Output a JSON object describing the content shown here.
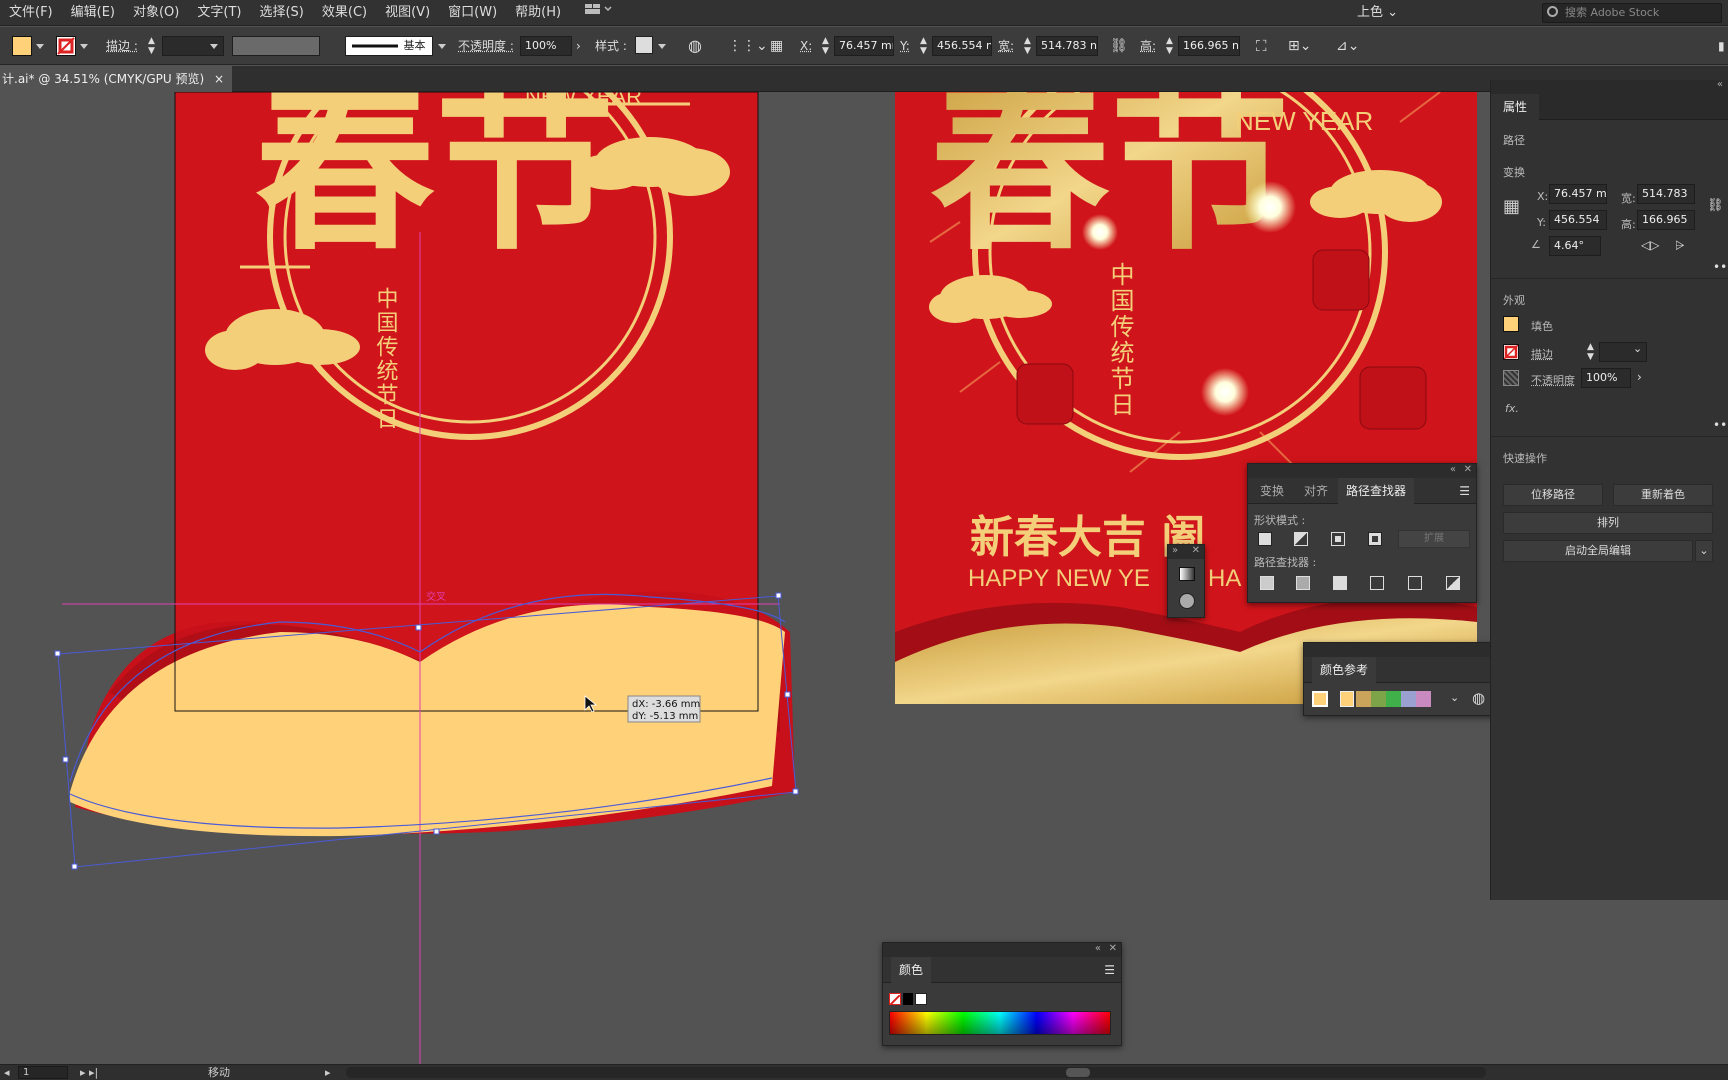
{
  "menu": {
    "items": [
      "文件(F)",
      "编辑(E)",
      "对象(O)",
      "文字(T)",
      "选择(S)",
      "效果(C)",
      "视图(V)",
      "窗口(W)",
      "帮助(H)"
    ],
    "workspace": "上色",
    "search_placeholder": "搜索 Adobe Stock"
  },
  "control": {
    "stroke_label": "描边 :",
    "stroke_style": "基本",
    "opacity_label": "不透明度 :",
    "opacity_value": "100%",
    "style_label": "样式 :",
    "x_label": "X:",
    "x_value": "76.457 mm",
    "y_label": "Y:",
    "y_value": "456.554 n",
    "w_label": "宽:",
    "w_value": "514.783 n",
    "h_label": "高:",
    "h_value": "166.965 n",
    "fill_color": "#ffd27a"
  },
  "document": {
    "tab_title": "计.ai* @ 34.51% (CMYK/GPU 预览)",
    "close": "×"
  },
  "canvas": {
    "left_art": {
      "title": "春节",
      "subtitle_cn": "中国传统节日",
      "new_year": "NEW YEAR"
    },
    "right_art": {
      "title": "春节",
      "subtitle_cn": "中国传统节日",
      "new_year": "NEW YEAR",
      "greeting_cn": "新春大吉 阖",
      "greeting_en": "HAPPY NEW YE",
      "greeting_en2": "HA"
    },
    "smart_guide_label": "交叉",
    "delta_x": "dX: -3.66 mm",
    "delta_y": "dY: -5.13 mm"
  },
  "properties": {
    "tab": "属性",
    "path_label": "路径",
    "transform_label": "变换",
    "x_label": "X:",
    "x_value": "76.457 m",
    "y_label": "Y:",
    "y_value": "456.554",
    "w_label": "宽:",
    "w_value": "514.783",
    "h_label": "高:",
    "h_value": "166.965",
    "angle_value": "4.64°",
    "appearance_label": "外观",
    "fill_label": "填色",
    "stroke_label": "描边",
    "opacity_label": "不透明度",
    "opacity_value": "100%",
    "fx_label": "fx.",
    "quick_actions_label": "快速操作",
    "offset_path": "位移路径",
    "recolor": "重新着色",
    "arrange": "排列",
    "global_edit": "启动全局编辑"
  },
  "pathfinder": {
    "tabs": [
      "变换",
      "对齐",
      "路径查找器"
    ],
    "shape_modes": "形状模式 :",
    "expand": "扩展",
    "pathfinders": "路径查找器 :"
  },
  "color_guide": {
    "title": "颜色参考",
    "swatches": [
      "#c9a45a",
      "#7ea44a",
      "#3fb04a",
      "#9aa0d0",
      "#c88ac0"
    ]
  },
  "color_panel": {
    "title": "颜色"
  },
  "status": {
    "page": "1",
    "tool": "移动"
  },
  "colors": {
    "poster_red": "#d0141b",
    "gold": "#f3cf7a",
    "wave": "#ffd27a",
    "selection": "#4a5bd6",
    "guide": "#e040b0"
  }
}
